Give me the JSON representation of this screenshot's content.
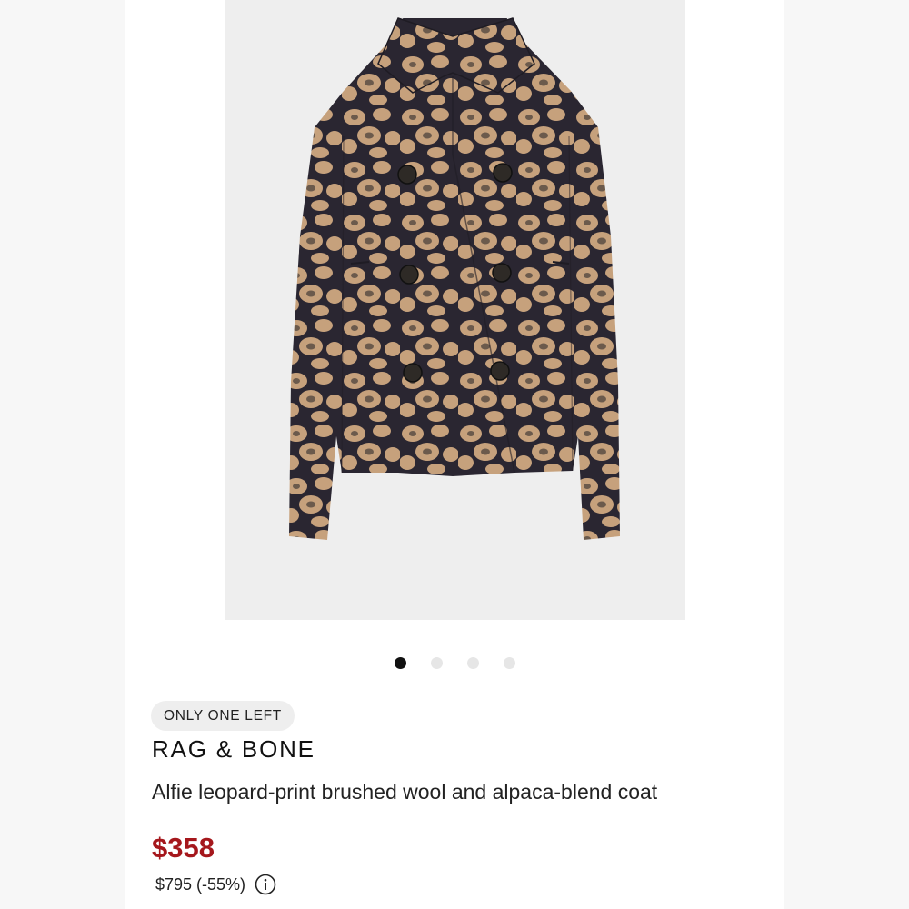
{
  "product": {
    "image_alt": "Leopard-print double-breasted coat",
    "badge": "ONLY ONE LEFT",
    "brand": "RAG & BONE",
    "title": "Alfie leopard-print brushed wool and alpaca-blend coat",
    "sale_price": "$358",
    "original_price": "$795 (-55%)"
  },
  "gallery": {
    "total_images": 4,
    "active_index": 0
  },
  "colors": {
    "sale_price": "#a5171c",
    "coat_base": "#2a2631",
    "coat_spots": "#c6a17c",
    "active_dot": "#111111",
    "inactive_dot": "#e6e6e6"
  },
  "icons": {
    "info": "info-circle-icon"
  }
}
